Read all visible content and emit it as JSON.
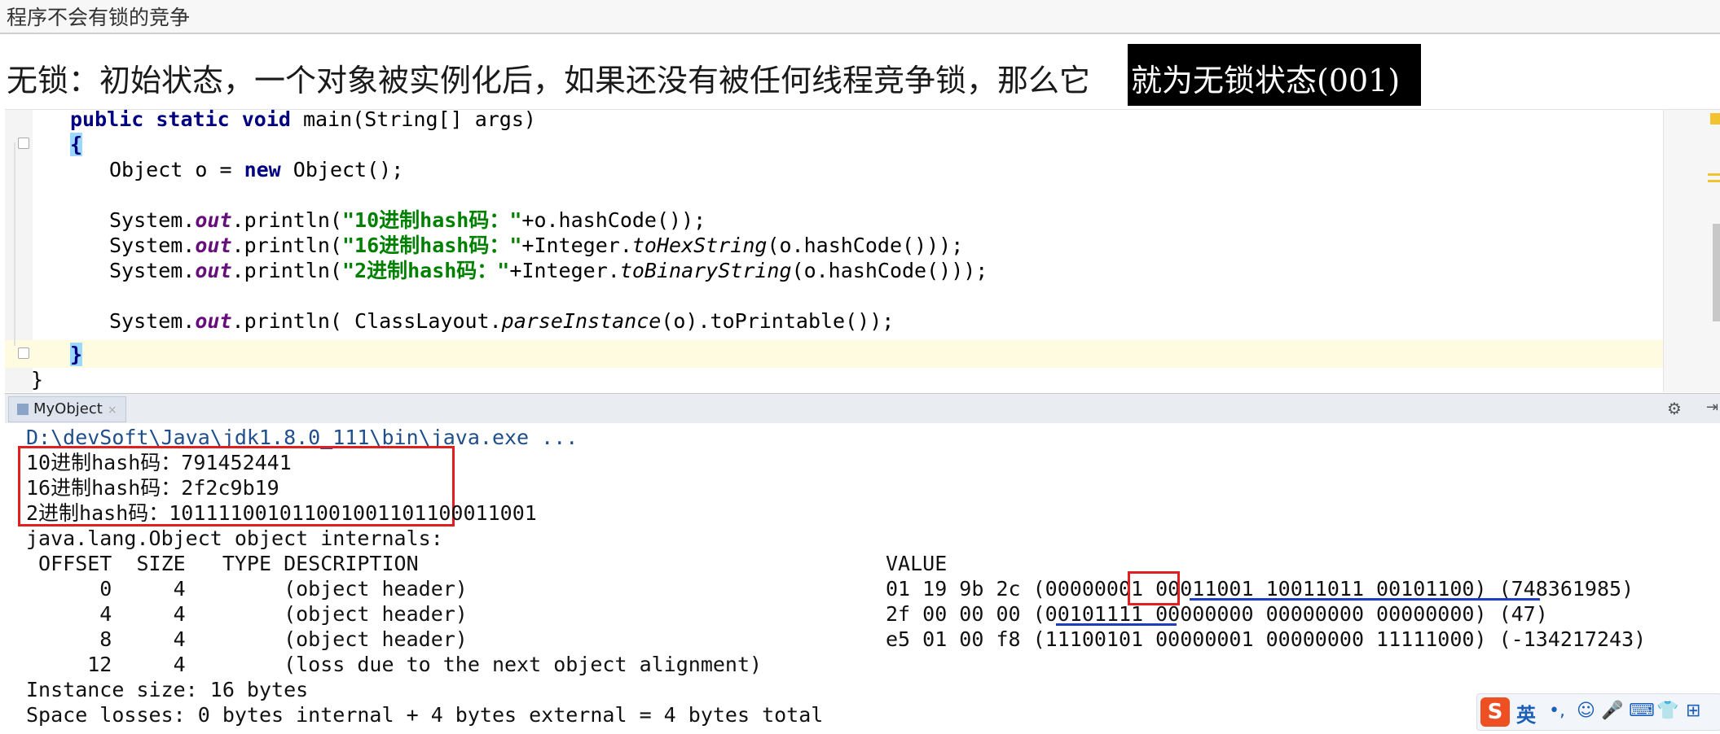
{
  "page_title": "程序不会有锁的竞争",
  "heading": {
    "plain": "无锁：初始状态，一个对象被实例化后，如果还没有被任何线程竞争锁，那么它",
    "highlighted": "就为无锁状态(001)"
  },
  "editor": {
    "line1_kw": "public static void",
    "line1_rest": " main(String[] args)",
    "open_brace": "{",
    "line3_type": "Object o = ",
    "line3_new": "new",
    "line3_rest": " Object();",
    "println": [
      {
        "pre": "System.",
        "field": "out",
        "mid": ".println(",
        "str": "\"10进制hash码：\"",
        "post1": "+o.hashCode());",
        "method": "",
        "post2": ""
      },
      {
        "pre": "System.",
        "field": "out",
        "mid": ".println(",
        "str": "\"16进制hash码：\"",
        "post1": "+Integer.",
        "method": "toHexString",
        "post2": "(o.hashCode()));"
      },
      {
        "pre": "System.",
        "field": "out",
        "mid": ".println(",
        "str": "\"2进制hash码：\"",
        "post1": "+Integer.",
        "method": "toBinaryString",
        "post2": "(o.hashCode()));"
      }
    ],
    "layout_line": {
      "pre": "System.",
      "field": "out",
      "mid": ".println( ClassLayout.",
      "method": "parseInstance",
      "post": "(o).toPrintable());"
    },
    "close_brace": "}",
    "class_close": "}"
  },
  "run_tab": {
    "label": "MyObject",
    "close": "×"
  },
  "console": {
    "command": "D:\\devSoft\\Java\\jdk1.8.0_111\\bin\\java.exe ...",
    "hash_lines": [
      "10进制hash码：791452441",
      "16进制hash码：2f2c9b19",
      "2进制hash码：101111001011001001101100011001"
    ],
    "internals_title": "java.lang.Object object internals:",
    "header_cols": " OFFSET  SIZE   TYPE DESCRIPTION",
    "value_col": "VALUE",
    "rows": [
      {
        "left": "      0     4        (object header)",
        "value": "01 19 9b 2c (00000001 00011001 10011011 00101100) (748361985)"
      },
      {
        "left": "      4     4        (object header)",
        "value": "2f 00 00 00 (00101111 00000000 00000000 00000000) (47)"
      },
      {
        "left": "      8     4        (object header)",
        "value": "e5 01 00 f8 (11100101 00000001 00000000 11111000) (-134217243)"
      },
      {
        "left": "     12     4        (loss due to the next object alignment)",
        "value": ""
      }
    ],
    "instance_size": "Instance size: 16 bytes",
    "space_losses": "Space losses: 0 bytes internal + 4 bytes external = 4 bytes total"
  },
  "ime": {
    "logo": "S",
    "lang": "英",
    "symbols": [
      "•,",
      "☺",
      "🎤",
      "⌨",
      "👕",
      "⊞"
    ]
  },
  "colors": {
    "keyword": "#000080",
    "string": "#008000",
    "field": "#660e7a",
    "highlight_box": "#e02020",
    "underline": "#1e3fbd"
  }
}
